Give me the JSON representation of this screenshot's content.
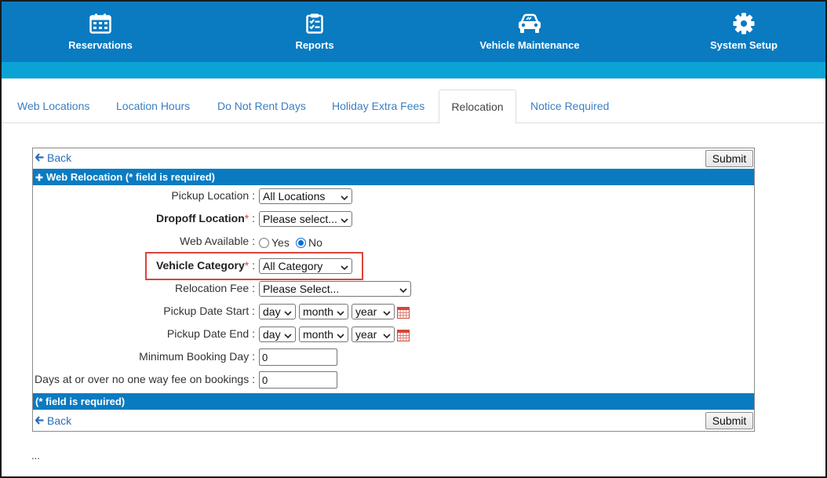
{
  "topnav": {
    "items": [
      {
        "label": "Reservations",
        "icon": "calendar-icon"
      },
      {
        "label": "Reports",
        "icon": "clipboard-icon"
      },
      {
        "label": "Vehicle Maintenance",
        "icon": "car-icon"
      },
      {
        "label": "System Setup",
        "icon": "gear-icon"
      }
    ],
    "color": "#0a7bc1",
    "subbar_color": "#0ba3d6"
  },
  "tabs": [
    {
      "label": "Web Locations"
    },
    {
      "label": "Location Hours"
    },
    {
      "label": "Do Not Rent Days"
    },
    {
      "label": "Holiday Extra Fees"
    },
    {
      "label": "Relocation",
      "active": true
    },
    {
      "label": "Notice Required"
    }
  ],
  "form": {
    "back_label": "Back",
    "submit_label": "Submit",
    "header_label": "Web Relocation (* field is required)",
    "footer_label": "(* field is required)",
    "pickup_location": {
      "label": "Pickup Location",
      "value": "All Locations"
    },
    "dropoff_location": {
      "label": "Dropoff Location",
      "required_mark": "*",
      "value": "Please select..."
    },
    "web_available": {
      "label": "Web Available",
      "options": [
        "Yes",
        "No"
      ],
      "selected": "No"
    },
    "vehicle_category": {
      "label": "Vehicle Category",
      "required_mark": "*",
      "value": "All Category"
    },
    "relocation_fee": {
      "label": "Relocation Fee",
      "value": "Please Select..."
    },
    "pickup_date_start": {
      "label": "Pickup Date Start",
      "day": "day",
      "month": "month",
      "year": "year"
    },
    "pickup_date_end": {
      "label": "Pickup Date End",
      "day": "day",
      "month": "month",
      "year": "year"
    },
    "minimum_booking_day": {
      "label": "Minimum Booking Day",
      "value": "0"
    },
    "no_one_way_fee_days": {
      "label": "Days at or over no one way fee on bookings",
      "value": "0"
    },
    "separator": ":"
  },
  "footer_ellipsis": "...",
  "colors": {
    "accent": "#0a7bc1",
    "link": "#2a6eb8",
    "required": "#e03c3c",
    "highlight": "#d9443c"
  }
}
